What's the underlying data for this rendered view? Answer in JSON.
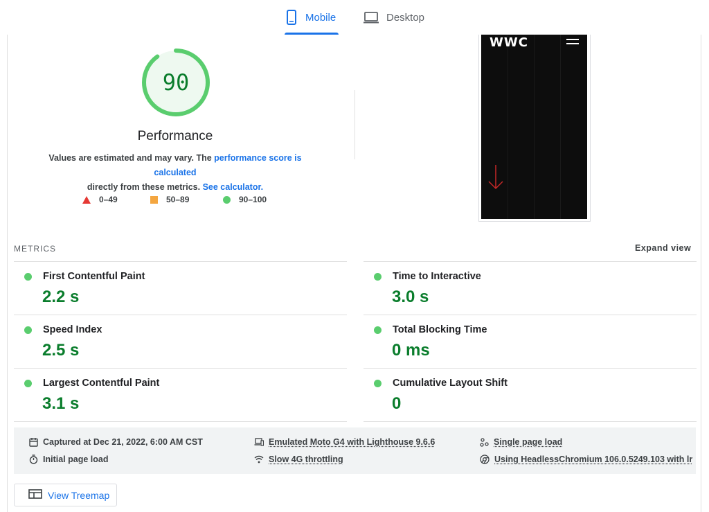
{
  "tabs": {
    "mobile": {
      "label": "Mobile",
      "icon": "smartphone-icon",
      "selected": true
    },
    "desktop": {
      "label": "Desktop",
      "icon": "laptop-icon",
      "selected": false
    }
  },
  "score": {
    "value": "90",
    "fraction": 0.9,
    "color": "#0a7d2c",
    "title": "Performance",
    "desc_prefix": "Values are estimated and may vary. The ",
    "desc_link1": "performance score is calculated",
    "desc_middle": " directly from these metrics. ",
    "desc_link2": "See calculator."
  },
  "legend": [
    {
      "label": "0–49",
      "shape": "triangle",
      "color": "#e53935"
    },
    {
      "label": "50–89",
      "shape": "square",
      "color": "#f4a640"
    },
    {
      "label": "90–100",
      "shape": "circle",
      "color": "#5acd6e"
    }
  ],
  "thumbnail": {
    "logo": "WWC"
  },
  "metrics_header": {
    "label": "METRICS",
    "expand": "Expand view"
  },
  "metrics": [
    {
      "title": "First Contentful Paint",
      "value": "2.2 s"
    },
    {
      "title": "Time to Interactive",
      "value": "3.0 s"
    },
    {
      "title": "Speed Index",
      "value": "2.5 s"
    },
    {
      "title": "Total Blocking Time",
      "value": "0 ms"
    },
    {
      "title": "Largest Contentful Paint",
      "value": "3.1 s"
    },
    {
      "title": "Cumulative Layout Shift",
      "value": "0"
    }
  ],
  "info": {
    "captured": "Captured at Dec 21, 2022, 6:00 AM CST",
    "initial": "Initial page load",
    "emulated": "Emulated Moto G4 with Lighthouse 9.6.6",
    "throttling": "Slow 4G throttling",
    "single": "Single page load",
    "browser": "Using HeadlessChromium 106.0.5249.103 with lr"
  },
  "treemap": {
    "label": "View Treemap"
  },
  "colors": {
    "accent": "#1a73e8",
    "pass": "#0a7d2c",
    "pass_light": "#5acd6e"
  }
}
